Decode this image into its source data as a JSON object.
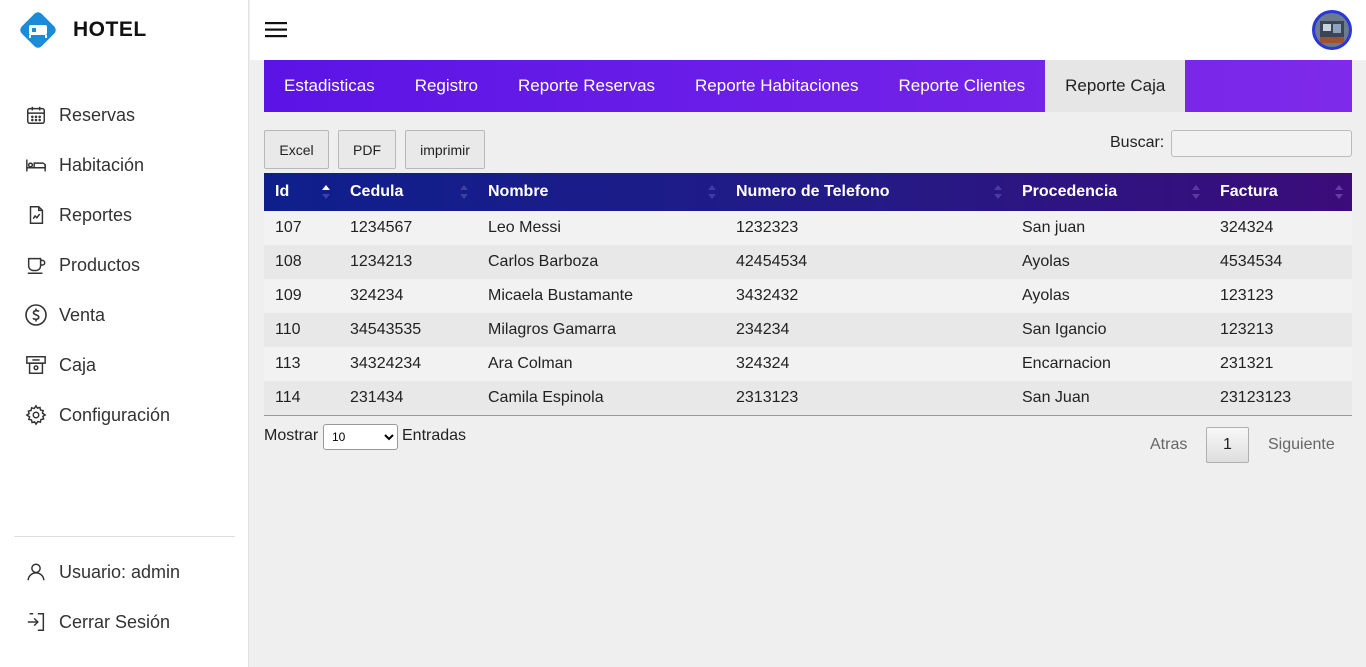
{
  "brand": {
    "name": "HOTEL",
    "logo_color": "#1a8cd8"
  },
  "sidebar": {
    "items": [
      {
        "label": "Reservas",
        "icon": "calendar-icon"
      },
      {
        "label": "Habitación",
        "icon": "bed-icon"
      },
      {
        "label": "Reportes",
        "icon": "report-icon"
      },
      {
        "label": "Productos",
        "icon": "cup-icon"
      },
      {
        "label": "Venta",
        "icon": "dollar-icon"
      },
      {
        "label": "Caja",
        "icon": "cash-register-icon"
      },
      {
        "label": "Configuración",
        "icon": "gear-icon"
      }
    ],
    "bottom": [
      {
        "label": "Usuario: admin",
        "icon": "user-icon"
      },
      {
        "label": "Cerrar Sesión",
        "icon": "logout-icon"
      }
    ]
  },
  "topbar": {
    "menu_icon": "hamburger-icon",
    "avatar_icon": "avatar"
  },
  "tabs": [
    {
      "label": "Estadisticas",
      "active": false
    },
    {
      "label": "Registro",
      "active": false
    },
    {
      "label": "Reporte Reservas",
      "active": false
    },
    {
      "label": "Reporte Habitaciones",
      "active": false
    },
    {
      "label": "Reporte Clientes",
      "active": false
    },
    {
      "label": "Reporte Caja",
      "active": true
    }
  ],
  "toolbar": {
    "excel_label": "Excel",
    "pdf_label": "PDF",
    "print_label": "imprimir"
  },
  "search": {
    "label": "Buscar:",
    "value": ""
  },
  "table": {
    "columns": [
      "Id",
      "Cedula",
      "Nombre",
      "Numero de Telefono",
      "Procedencia",
      "Factura"
    ],
    "rows": [
      [
        "107",
        "1234567",
        "Leo Messi",
        "1232323",
        "San juan",
        "324324"
      ],
      [
        "108",
        "1234213",
        "Carlos Barboza",
        "42454534",
        "Ayolas",
        "4534534"
      ],
      [
        "109",
        "324234",
        "Micaela Bustamante",
        "3432432",
        "Ayolas",
        "123123"
      ],
      [
        "110",
        "34543535",
        "Milagros Gamarra",
        "234234",
        "San Igancio",
        "123213"
      ],
      [
        "113",
        "34324234",
        "Ara Colman",
        "324324",
        "Encarnacion",
        "231321"
      ],
      [
        "114",
        "231434",
        "Camila Espinola",
        "2313123",
        "San Juan",
        "23123123"
      ]
    ]
  },
  "footer": {
    "show_label": "Mostrar",
    "page_size": "10",
    "entries_label": "Entradas",
    "prev_label": "Atras",
    "current_page": "1",
    "next_label": "Siguiente"
  },
  "colors": {
    "tab_bar_start": "#5b14e6",
    "tab_bar_end": "#7f2aea",
    "header_start": "#0e1f8c",
    "header_end": "#3b0c7a"
  }
}
